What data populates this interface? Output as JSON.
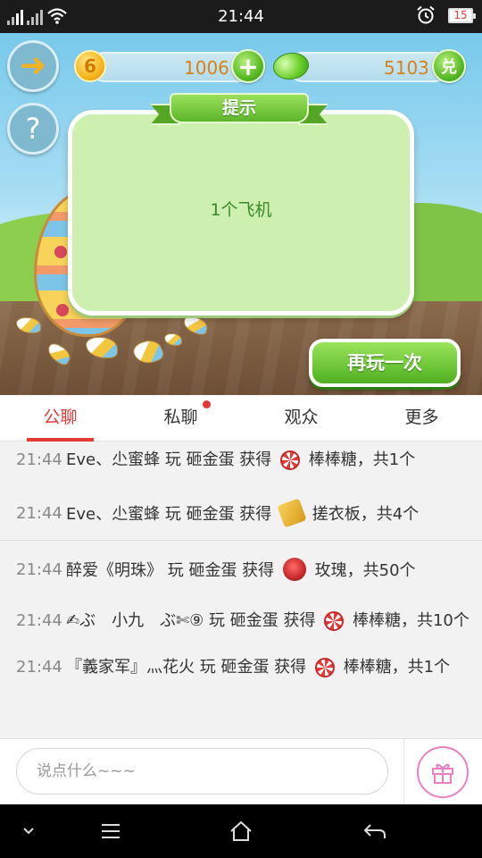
{
  "status_bar": {
    "time": "21:44",
    "battery": "15"
  },
  "game": {
    "coins": {
      "badge": "6",
      "value": "1006"
    },
    "gems": {
      "value": "5103",
      "exchange_label": "兑"
    },
    "dialog": {
      "title": "提示",
      "message": "1个飞机"
    },
    "replay_label": "再玩一次",
    "help_label": "?"
  },
  "tabs": [
    {
      "label": "公聊",
      "active": true
    },
    {
      "label": "私聊",
      "active": false
    },
    {
      "label": "观众",
      "active": false
    },
    {
      "label": "更多",
      "active": false
    }
  ],
  "messages": [
    {
      "time": "21:44",
      "user": "Eve、尐蜜蜂",
      "action": "玩 砸金蛋 获得",
      "gift_icon": "lollipop-icon",
      "gift": "棒棒糖，共1个"
    },
    {
      "time": "21:44",
      "user": "Eve、尐蜜蜂",
      "action": "玩 砸金蛋 获得",
      "gift_icon": "washboard-icon",
      "gift": "搓衣板，共4个"
    },
    {
      "time": "21:44",
      "user": "醉爱《明珠》",
      "action": "玩 砸金蛋 获得",
      "gift_icon": "rose-icon",
      "gift": "玫瑰，共50个"
    },
    {
      "time": "21:44",
      "user": "✍ぶ　小九　ぶ✄⑨",
      "action": "玩 砸金蛋 获得",
      "gift_icon": "lollipop-icon",
      "gift": "棒棒糖，共10个"
    },
    {
      "time": "21:44",
      "user": "『義家军』灬花火",
      "action": "玩 砸金蛋 获得",
      "gift_icon": "lollipop-icon",
      "gift": "棒棒糖，共1个"
    }
  ],
  "input": {
    "placeholder": "说点什么~~~"
  },
  "colors": {
    "accent": "#e53935",
    "game_green": "#52b61e",
    "coin_text": "#d8801a"
  }
}
